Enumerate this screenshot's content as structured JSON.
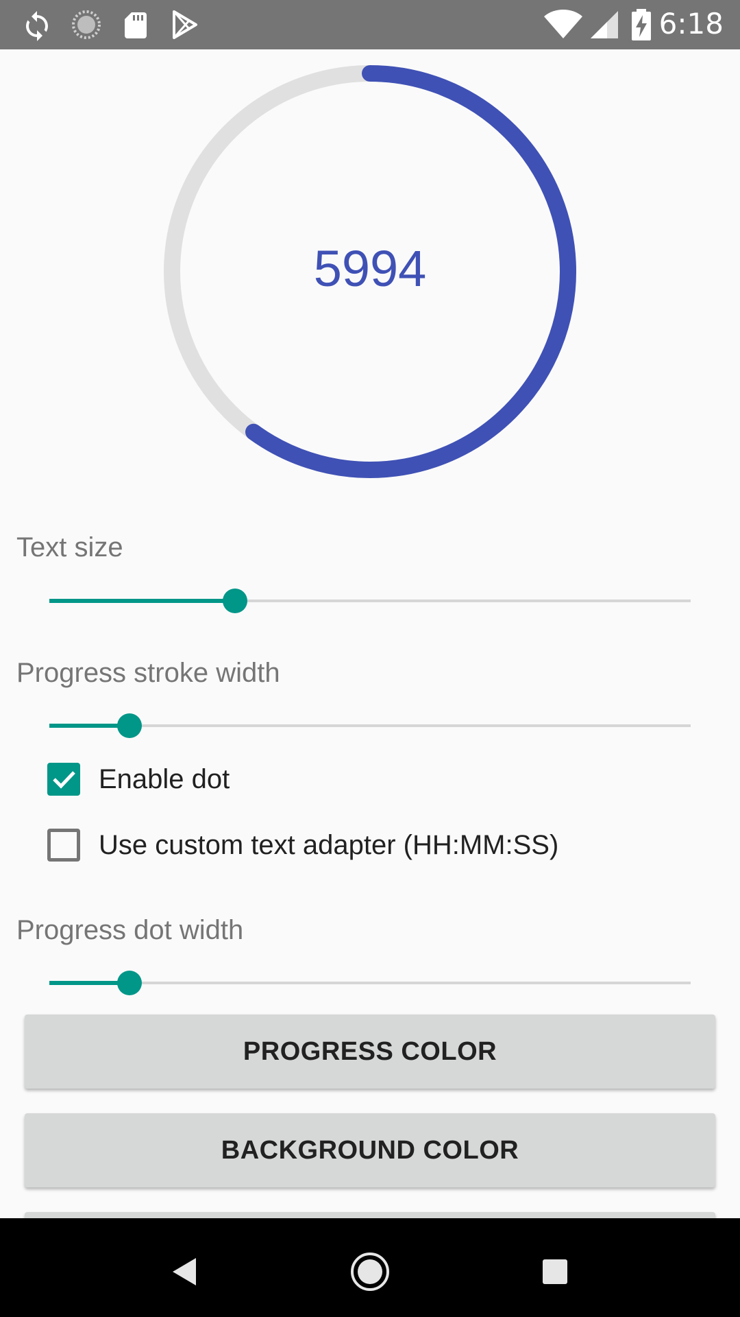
{
  "status_bar": {
    "time": "6:18",
    "left_icons": [
      "sync-icon",
      "loading-icon",
      "sd-card-icon",
      "play-store-icon"
    ],
    "right_icons": [
      "wifi-icon",
      "cell-signal-icon",
      "battery-charging-icon"
    ]
  },
  "progress": {
    "display_value": "5994",
    "fraction": 0.6,
    "progress_color": "#3f51b5",
    "background_color": "#e0e0e0"
  },
  "controls": {
    "text_size": {
      "label": "Text size",
      "fraction": 0.29
    },
    "stroke_width": {
      "label": "Progress stroke width",
      "fraction": 0.125
    },
    "enable_dot": {
      "label": "Enable dot",
      "checked": true
    },
    "custom_adapter": {
      "label": "Use custom text adapter (HH:MM:SS)",
      "checked": false
    },
    "dot_width": {
      "label": "Progress dot width",
      "fraction": 0.125
    }
  },
  "buttons": {
    "progress_color": "PROGRESS COLOR",
    "background_color": "BACKGROUND COLOR"
  },
  "colors": {
    "accent": "#009688",
    "primary": "#3f51b5"
  },
  "nav_bar": {
    "icons": [
      "back-icon",
      "home-icon",
      "recents-icon"
    ]
  }
}
